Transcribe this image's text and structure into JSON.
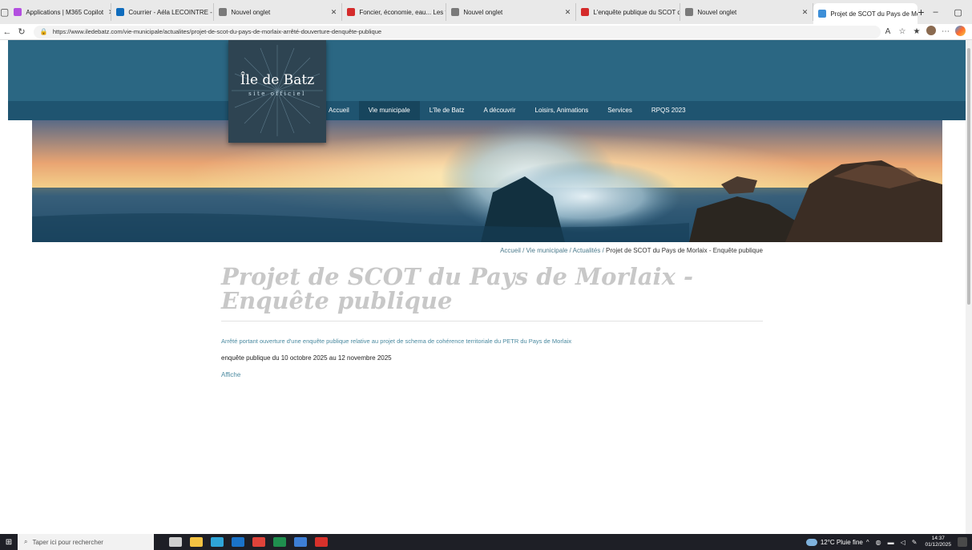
{
  "browser": {
    "tabs": [
      {
        "label": "Applications | M365 Copilot",
        "color": "#b34fe0"
      },
      {
        "label": "Courrier - Aéla LECOINTRE - C",
        "color": "#0f6cbd"
      },
      {
        "label": "Nouvel onglet",
        "color": "#7a7a7a"
      },
      {
        "label": "Foncier, économie, eau... Les t",
        "color": "#d42b2b"
      },
      {
        "label": "Nouvel onglet",
        "color": "#7a7a7a"
      },
      {
        "label": "L'enquête publique du SCOT d",
        "color": "#d42b2b"
      },
      {
        "label": "Nouvel onglet",
        "color": "#7a7a7a"
      },
      {
        "label": "Projet de SCOT du Pays de Mo",
        "color": "#3d8fd8"
      }
    ],
    "new_tab": "+",
    "window_controls": {
      "minimize": "–",
      "restore": "▢",
      "close": "✕"
    },
    "url": "https://www.iledebatz.com/vie-municipale/actualites/projet-de-scot-du-pays-de-morlaix-arrêté-douverture-denquête-publique"
  },
  "site": {
    "logo_title": "Île de Batz",
    "logo_subtitle": "site officiel",
    "nav": [
      {
        "label": "Accueil",
        "current": false
      },
      {
        "label": "Vie municipale",
        "current": true
      },
      {
        "label": "L'île de Batz",
        "current": false
      },
      {
        "label": "A découvrir",
        "current": false
      },
      {
        "label": "Loisirs, Animations",
        "current": false
      },
      {
        "label": "Services",
        "current": false
      },
      {
        "label": "RPQS 2023",
        "current": false
      }
    ],
    "colors": {
      "header": "#2b6783",
      "nav": "#1f5470",
      "logo_box": "#2e4452",
      "link": "#4b8aa0",
      "title": "#c8c8c8"
    }
  },
  "breadcrumb": {
    "items": [
      "Accueil",
      "Vie municipale",
      "Actualités"
    ],
    "current": "Projet de SCOT du Pays de Morlaix - Enquête publique",
    "separator": "/"
  },
  "article": {
    "title": "Projet de SCOT du Pays de Morlaix - Enquête publique",
    "link_text": "Arrêté portant ouverture d'une enquête publique relative au projet de schema de cohérence territoriale du PETR du Pays de Morlaix",
    "body_text": "enquête publique du 10 octobre 2025 au 12 novembre 2025",
    "affiche": "Affiche"
  },
  "taskbar": {
    "search_placeholder": "Taper ici pour rechercher",
    "weather": "12°C Pluie fine",
    "time": "14:37",
    "date": "01/12/2025",
    "apps": [
      {
        "name": "task-view",
        "color": "#cfcfcf"
      },
      {
        "name": "file-explorer",
        "color": "#f3c242"
      },
      {
        "name": "edge",
        "color": "#2fa5d8"
      },
      {
        "name": "outlook",
        "color": "#1a73c9"
      },
      {
        "name": "chrome",
        "color": "#e0433a"
      },
      {
        "name": "excel",
        "color": "#1f8f4e"
      },
      {
        "name": "app-blue",
        "color": "#3e7fd6"
      },
      {
        "name": "acrobat",
        "color": "#d8312b"
      }
    ]
  }
}
